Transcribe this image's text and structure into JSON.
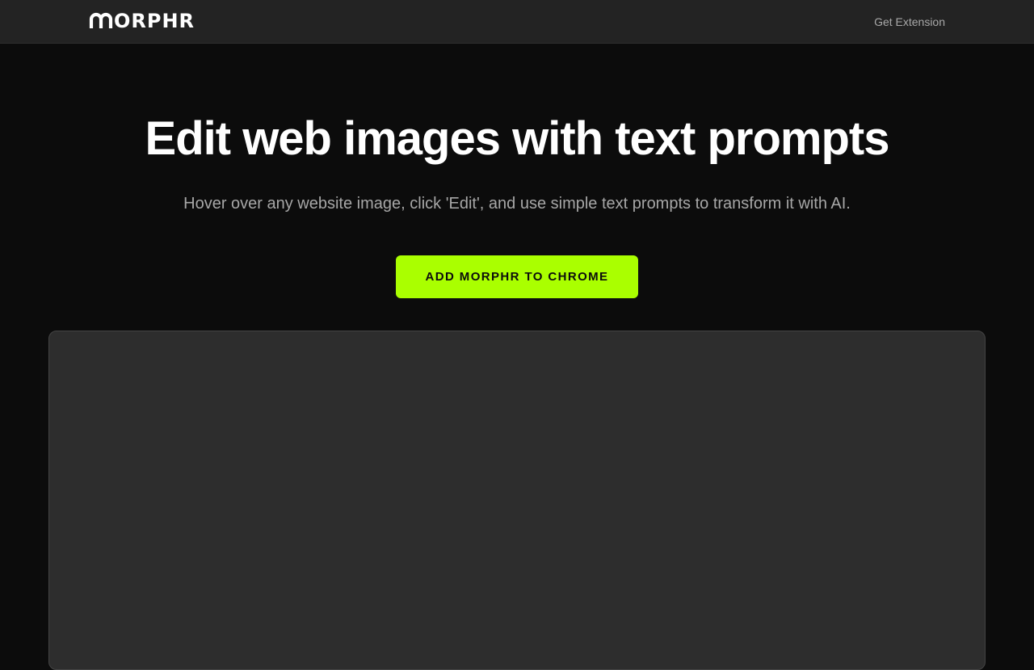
{
  "brand": {
    "logo_text": "ORPHR",
    "logo_icon": "morphr-m-logo-icon"
  },
  "nav": {
    "get_extension": "Get Extension"
  },
  "hero": {
    "title": "Edit web images with text prompts",
    "subtitle": "Hover over any website image, click 'Edit', and use simple text prompts to transform it with AI.",
    "cta_label": "ADD MORPHR TO CHROME"
  },
  "colors": {
    "background": "#0c0c0c",
    "header": "#232323",
    "accent": "#aaff00",
    "panel": "#2d2d2d",
    "muted_text": "#a7a7a7"
  }
}
